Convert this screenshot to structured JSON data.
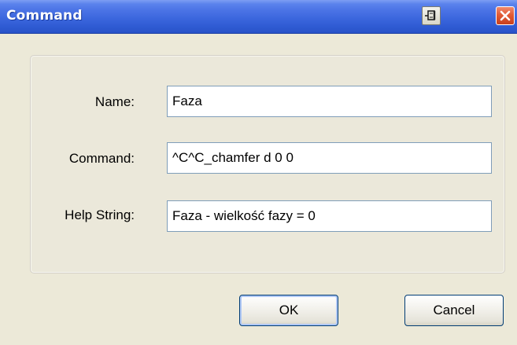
{
  "window": {
    "title": "Command",
    "pin_icon": "pin-icon",
    "close_icon": "close-icon"
  },
  "form": {
    "fields": [
      {
        "label": "Name:",
        "value": "Faza"
      },
      {
        "label": "Command:",
        "value": "^C^C_chamfer d 0 0"
      },
      {
        "label": "Help String:",
        "value": "Faza - wielkość fazy = 0"
      }
    ]
  },
  "buttons": {
    "ok_label": "OK",
    "cancel_label": "Cancel"
  },
  "colors": {
    "titlebar": "#3c67de",
    "dialog_bg": "#ece9d8",
    "close_button": "#e15b36",
    "input_border": "#7f9db9"
  }
}
